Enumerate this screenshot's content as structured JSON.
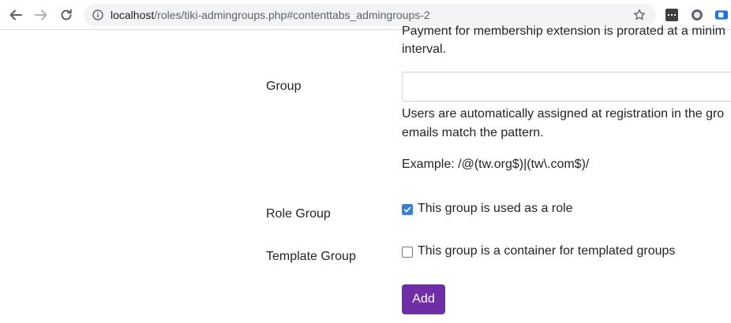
{
  "browser": {
    "url_host": "localhost",
    "url_path": "/roles/tiki-admingroups.php#contenttabs_admingroups-2"
  },
  "page": {
    "prorate_text_line1": "Payment for membership extension is prorated at a minim",
    "prorate_text_line2": "interval.",
    "group_label": "Group",
    "group_input_value": "",
    "group_help_line1": "Users are automatically assigned at registration in the gro",
    "group_help_line2": "emails match the pattern.",
    "group_example": "Example: /@(tw.org$)|(tw\\.com$)/",
    "role_group_label": "Role Group",
    "role_group_checkbox_label": "This group is used as a role",
    "role_group_checked": true,
    "template_group_label": "Template Group",
    "template_group_checkbox_label": "This group is a container for templated groups",
    "template_group_checked": false,
    "add_button_label": "Add"
  },
  "colors": {
    "accent": "#6f2da8",
    "checkbox_focus": "#3b7ddd"
  }
}
